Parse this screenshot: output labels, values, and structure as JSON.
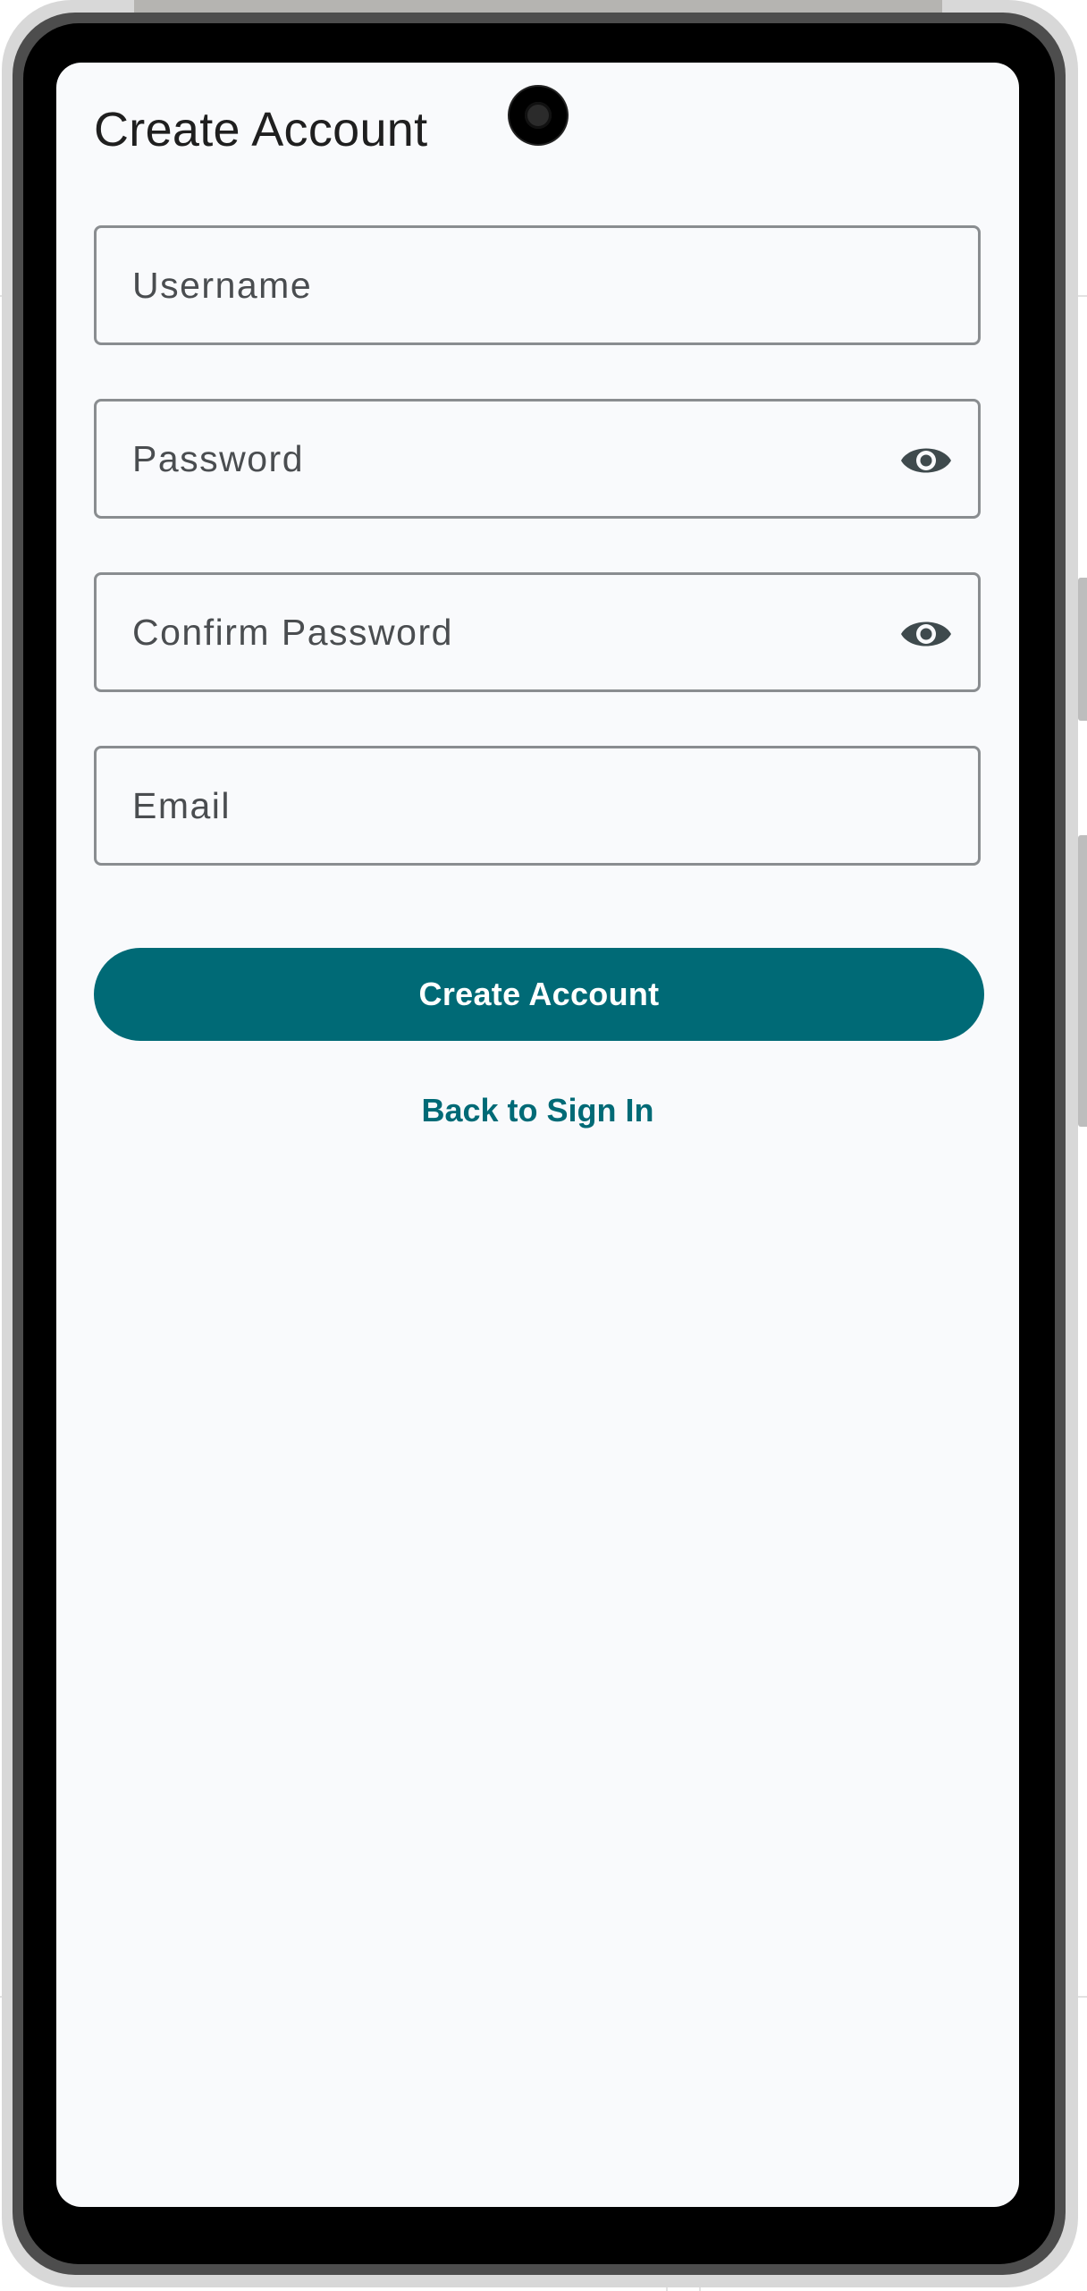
{
  "screen": {
    "title": "Create Account"
  },
  "form": {
    "username": {
      "value": "",
      "placeholder": "Username"
    },
    "password": {
      "value": "",
      "placeholder": "Password",
      "icon": "eye-icon"
    },
    "confirm_password": {
      "value": "",
      "placeholder": "Confirm Password",
      "icon": "eye-icon"
    },
    "email": {
      "value": "",
      "placeholder": "Email"
    }
  },
  "actions": {
    "submit_label": "Create Account",
    "back_label": "Back to Sign In"
  },
  "colors": {
    "accent": "#006a76",
    "background": "#f9fafc",
    "field_border": "#8a8d90",
    "icon": "#3f4a4d"
  }
}
